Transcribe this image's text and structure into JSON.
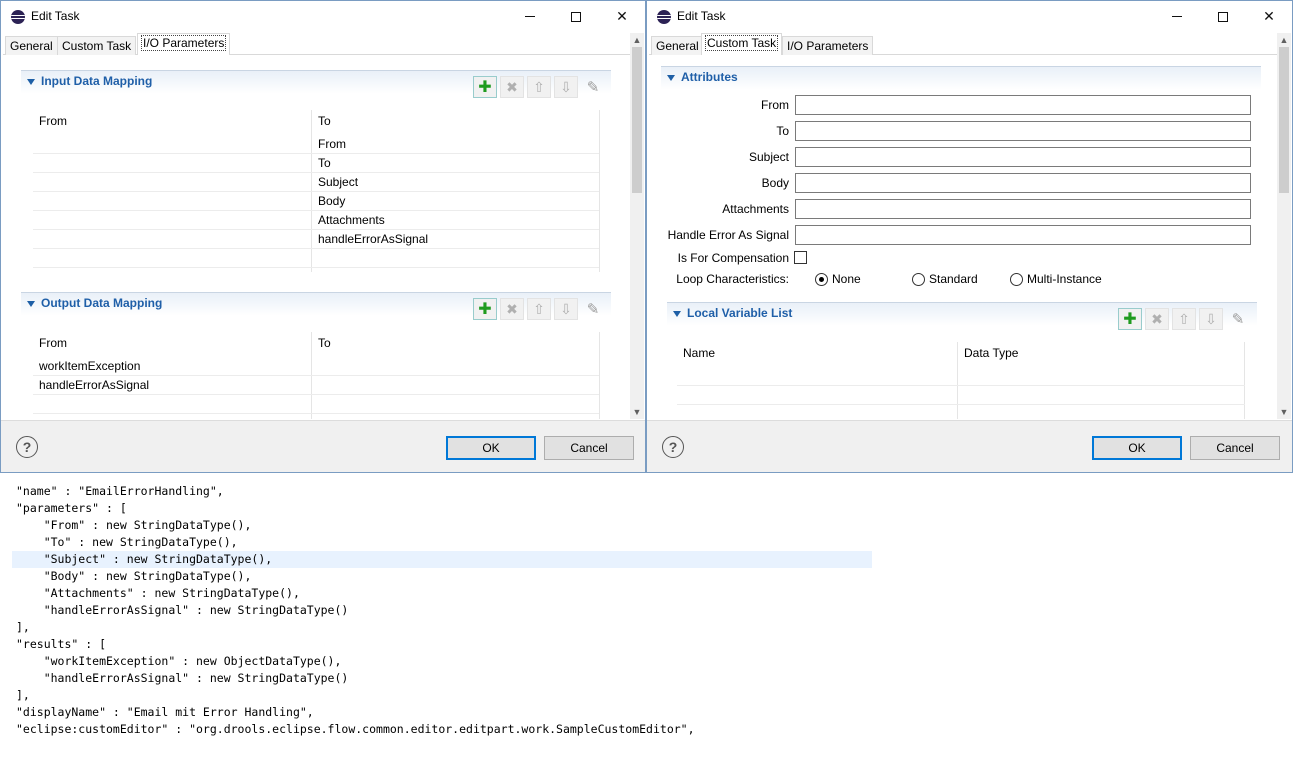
{
  "left_dialog": {
    "title": "Edit Task",
    "tabs": [
      {
        "label": "General",
        "active": false
      },
      {
        "label": "Custom Task",
        "active": false
      },
      {
        "label": "I/O Parameters",
        "active": true
      }
    ],
    "input_mapping": {
      "title": "Input Data Mapping",
      "columns": [
        "From",
        "To"
      ],
      "rows": [
        {
          "from": "",
          "to": "From"
        },
        {
          "from": "",
          "to": "To"
        },
        {
          "from": "",
          "to": "Subject"
        },
        {
          "from": "",
          "to": "Body"
        },
        {
          "from": "",
          "to": "Attachments"
        },
        {
          "from": "",
          "to": "handleErrorAsSignal"
        },
        {
          "from": "",
          "to": ""
        }
      ]
    },
    "output_mapping": {
      "title": "Output Data Mapping",
      "columns": [
        "From",
        "To"
      ],
      "rows": [
        {
          "from": "workItemException",
          "to": ""
        },
        {
          "from": "handleErrorAsSignal",
          "to": ""
        },
        {
          "from": "",
          "to": ""
        }
      ]
    },
    "ok_label": "OK",
    "cancel_label": "Cancel",
    "help_glyph": "?"
  },
  "right_dialog": {
    "title": "Edit Task",
    "tabs": [
      {
        "label": "General",
        "active": false
      },
      {
        "label": "Custom Task",
        "active": true
      },
      {
        "label": "I/O Parameters",
        "active": false
      }
    ],
    "attributes": {
      "title": "Attributes",
      "fields": [
        {
          "label": "From",
          "value": ""
        },
        {
          "label": "To",
          "value": ""
        },
        {
          "label": "Subject",
          "value": ""
        },
        {
          "label": "Body",
          "value": ""
        },
        {
          "label": "Attachments",
          "value": ""
        },
        {
          "label": "Handle Error As Signal",
          "value": ""
        }
      ],
      "compensation_label": "Is For Compensation",
      "compensation_checked": false,
      "loop_label": "Loop Characteristics:",
      "loop_options": [
        {
          "label": "None",
          "selected": true
        },
        {
          "label": "Standard",
          "selected": false
        },
        {
          "label": "Multi-Instance",
          "selected": false
        }
      ]
    },
    "local_vars": {
      "title": "Local Variable List",
      "columns": [
        "Name",
        "Data Type"
      ]
    },
    "ok_label": "OK",
    "cancel_label": "Cancel",
    "help_glyph": "?"
  },
  "code_lines": [
    "\"name\" : \"EmailErrorHandling\",",
    "\"parameters\" : [",
    "    \"From\" : new StringDataType(),",
    "    \"To\" : new StringDataType(),",
    "    \"Subject\" : new StringDataType(),",
    "    \"Body\" : new StringDataType(),",
    "    \"Attachments\" : new StringDataType(),",
    "    \"handleErrorAsSignal\" : new StringDataType()",
    "],",
    "\"results\" : [",
    "    \"workItemException\" : new ObjectDataType(),",
    "    \"handleErrorAsSignal\" : new StringDataType()",
    "],",
    "\"displayName\" : \"Email mit Error Handling\",",
    "\"eclipse:customEditor\" : \"org.drools.eclipse.flow.common.editor.editpart.work.SampleCustomEditor\","
  ],
  "highlighted_code_line": 4
}
